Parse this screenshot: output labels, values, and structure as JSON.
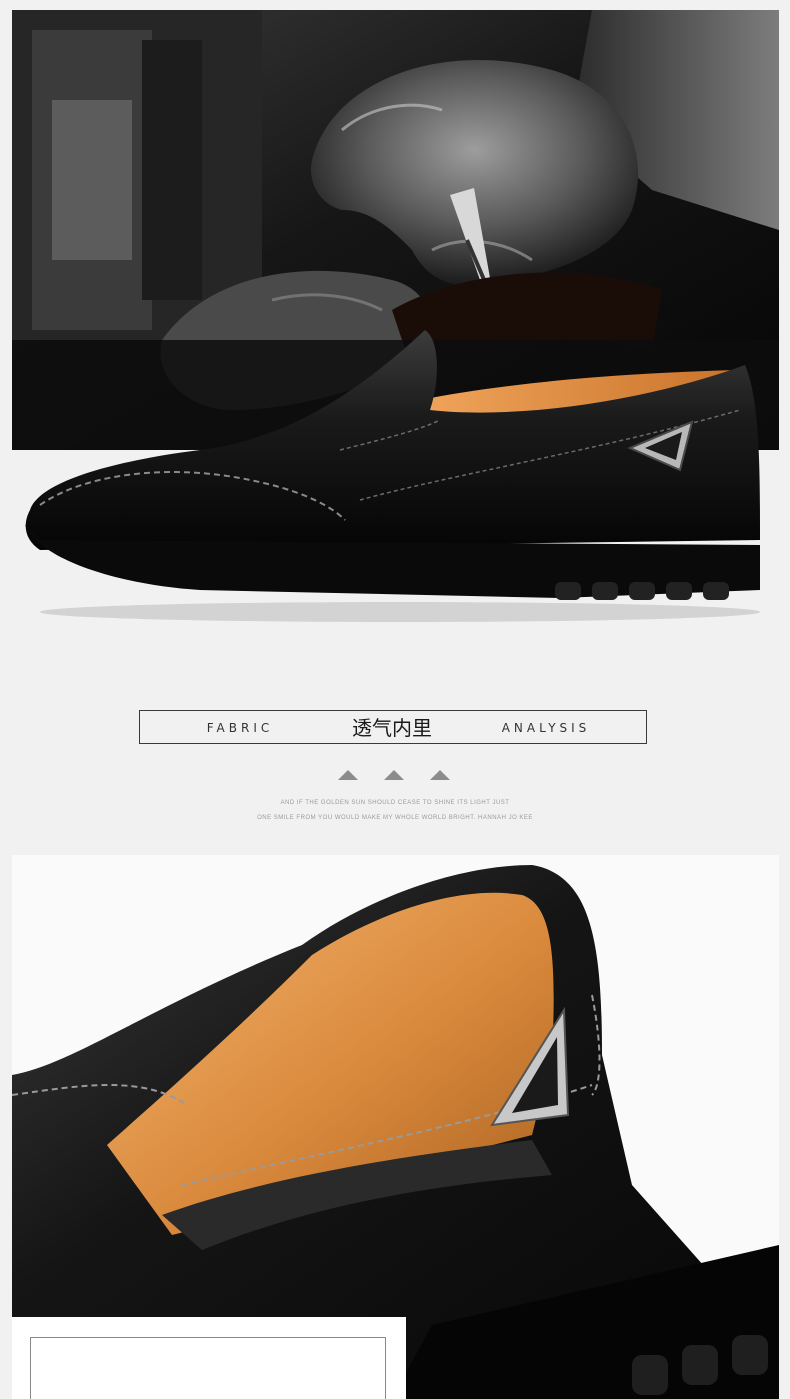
{
  "banner": {
    "left": "FABRIC",
    "center": "透气内里",
    "right": "ANALYSIS"
  },
  "tagline": {
    "line1": "AND IF THE GOLDEN SUN SHOULD CEASE TO SHINE ITS LIGHT JUST",
    "line2": "ONE SMILE FROM YOU WOULD MAKE MY WHOLE WORLD BRIGHT. HANNAH JO KEE"
  },
  "colors": {
    "page_background": "#f1f1f1",
    "leather": "#111111",
    "lining": "#d9893c",
    "banner_border": "#3a3a3a",
    "triangles": "#8c8c8c"
  },
  "icons": [
    "up-triangle-icon",
    "up-triangle-icon",
    "up-triangle-icon",
    "metal-triangle-badge-icon"
  ]
}
